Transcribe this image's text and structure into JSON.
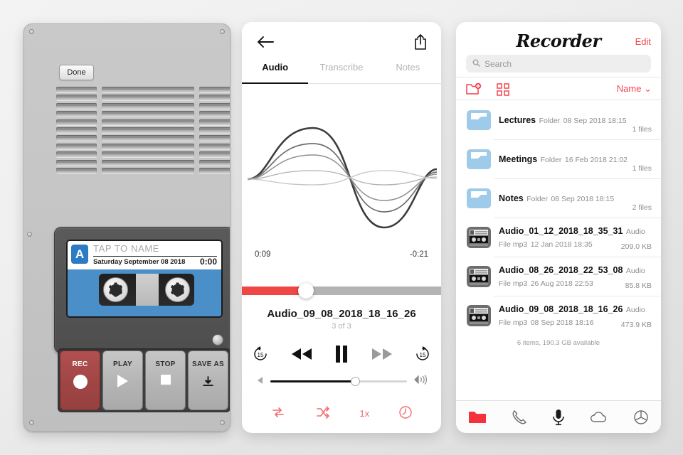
{
  "recorder_panel": {
    "done_label": "Done",
    "cassette": {
      "side_badge": "A",
      "name_placeholder": "TAP TO NAME",
      "date": "Saturday September 08 2018",
      "time": "0:00"
    },
    "transport": [
      {
        "label": "REC",
        "icon": "record-circle-icon",
        "style": "red"
      },
      {
        "label": "PLAY",
        "icon": "play-triangle-icon",
        "style": "grey"
      },
      {
        "label": "STOP",
        "icon": "stop-square-icon",
        "style": "grey"
      },
      {
        "label": "SAVE AS",
        "icon": "download-tray-icon",
        "style": "grey"
      }
    ]
  },
  "player_panel": {
    "back_icon": "back-arrow-icon",
    "share_icon": "share-upload-icon",
    "tabs": [
      {
        "label": "Audio",
        "active": true
      },
      {
        "label": "Transcribe",
        "active": false
      },
      {
        "label": "Notes",
        "active": false
      }
    ],
    "time_elapsed": "0:09",
    "time_remaining": "-0:21",
    "progress_percent": 32,
    "track_title": "Audio_09_08_2018_18_16_26",
    "track_index": "3 of 3",
    "transport": [
      {
        "name": "rewind-15-icon",
        "label": "15"
      },
      {
        "name": "previous-track-icon",
        "label": ""
      },
      {
        "name": "pause-icon",
        "label": ""
      },
      {
        "name": "next-track-icon",
        "label": ""
      },
      {
        "name": "forward-15-icon",
        "label": "15"
      }
    ],
    "volume_percent": 62,
    "modes": [
      {
        "name": "repeat-icon",
        "label": ""
      },
      {
        "name": "shuffle-icon",
        "label": ""
      },
      {
        "name": "speed-icon",
        "label": "1x"
      },
      {
        "name": "timer-icon",
        "label": ""
      }
    ]
  },
  "browser_panel": {
    "title": "Recorder",
    "edit_label": "Edit",
    "search_placeholder": "Search",
    "new_folder_icon": "new-folder-icon",
    "grid_view_icon": "grid-view-icon",
    "sort_label": "Name",
    "files": [
      {
        "name": "Lectures",
        "type": "Folder",
        "date": "08 Sep 2018 18:15",
        "meta": "1 files",
        "icon": "folder-icon"
      },
      {
        "name": "Meetings",
        "type": "Folder",
        "date": "16 Feb 2018 21:02",
        "meta": "1 files",
        "icon": "folder-icon"
      },
      {
        "name": "Notes",
        "type": "Folder",
        "date": "08 Sep 2018 18:15",
        "meta": "2 files",
        "icon": "folder-icon"
      },
      {
        "name": "Audio_01_12_2018_18_35_31",
        "type": "Audio File mp3",
        "date": "12 Jan 2018 18:35",
        "meta": "209.0 KB",
        "icon": "cassette-icon"
      },
      {
        "name": "Audio_08_26_2018_22_53_08",
        "type": "Audio File mp3",
        "date": "26 Aug 2018 22:53",
        "meta": "85.8 KB",
        "icon": "cassette-icon"
      },
      {
        "name": "Audio_09_08_2018_18_16_26",
        "type": "Audio File mp3",
        "date": "08 Sep 2018 18:16",
        "meta": "473.9 KB",
        "icon": "cassette-icon"
      }
    ],
    "footer": "6 items, 190.3 GB available",
    "tabs": [
      {
        "name": "files-tab-icon",
        "active": true
      },
      {
        "name": "phone-tab-icon",
        "active": false
      },
      {
        "name": "record-tab-icon",
        "active": false
      },
      {
        "name": "cloud-tab-icon",
        "active": false
      },
      {
        "name": "settings-tab-icon",
        "active": false
      }
    ]
  },
  "colors": {
    "accent_red": "#f4444e",
    "progress_red": "#ef4646",
    "mode_red": "#ef6d6d",
    "cassette_blue": "#4a8fc8",
    "folder_blue": "#9ecbea",
    "rec_red": "#a04545"
  }
}
